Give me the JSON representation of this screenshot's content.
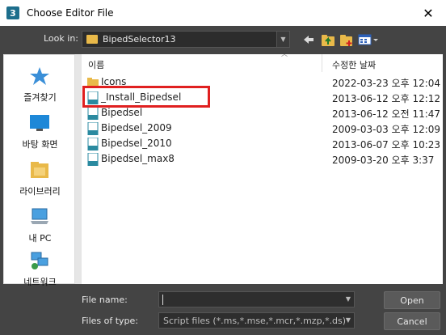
{
  "window": {
    "title": "Choose Editor File",
    "app_icon_text": "3",
    "close_glyph": "✕"
  },
  "toolbar": {
    "look_in_label": "Look in:",
    "current_folder": "BipedSelector13"
  },
  "places": [
    {
      "label": "즐겨찾기",
      "icon": "star-icon"
    },
    {
      "label": "바탕 화면",
      "icon": "desktop-icon"
    },
    {
      "label": "라이브러리",
      "icon": "library-icon"
    },
    {
      "label": "내 PC",
      "icon": "computer-icon"
    },
    {
      "label": "네트워크",
      "icon": "network-icon"
    }
  ],
  "file_list": {
    "columns": {
      "name": "이름",
      "date": "수정한 날짜"
    },
    "rows": [
      {
        "name": "Icons",
        "date": "2022-03-23 오후 12:04",
        "type": "folder"
      },
      {
        "name": "_Install_Bipedsel",
        "date": "2013-06-12 오후 12:12",
        "type": "ms"
      },
      {
        "name": "Bipedsel",
        "date": "2013-06-12 오전 11:47",
        "type": "mcr"
      },
      {
        "name": "Bipedsel_2009",
        "date": "2009-03-03 오후 12:09",
        "type": "mcr"
      },
      {
        "name": "Bipedsel_2010",
        "date": "2013-06-07 오후 10:23",
        "type": "mcr"
      },
      {
        "name": "Bipedsel_max8",
        "date": "2009-03-20 오후 3:37",
        "type": "mcr"
      }
    ]
  },
  "bottom": {
    "file_name_label": "File name:",
    "file_name_value": "",
    "files_of_type_label": "Files of type:",
    "files_of_type_value": "Script files (*.ms,*.mse,*.mcr,*.mzp,*.ds)",
    "open_label": "Open",
    "cancel_label": "Cancel"
  },
  "colors": {
    "dialog_bg": "#444444",
    "highlight": "#e02020",
    "folder": "#e9b949"
  }
}
